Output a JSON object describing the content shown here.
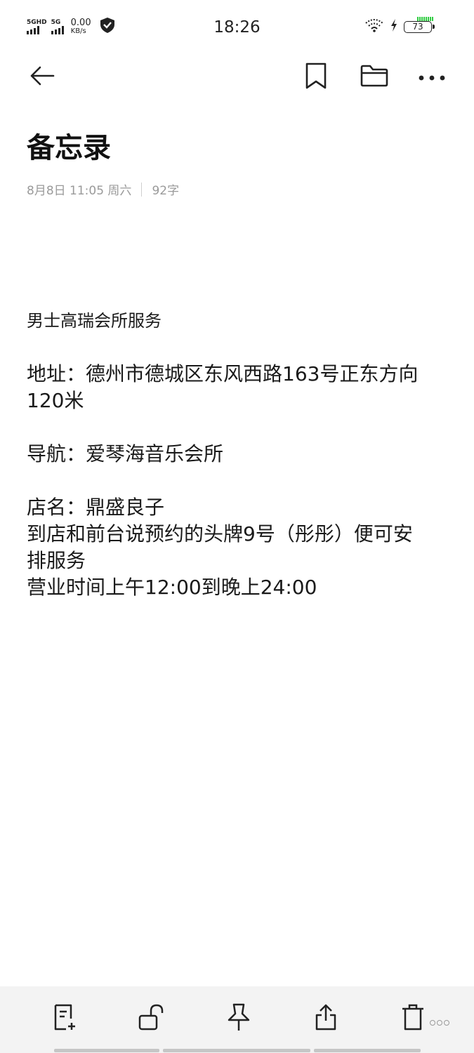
{
  "status_bar": {
    "sim1_label": "5GHD",
    "sim2_label": "5G",
    "speed_value": "0.00",
    "speed_unit": "KB/s",
    "time": "18:26",
    "battery_level": "73"
  },
  "toolbar": {
    "back_icon": "arrow-left-icon",
    "bookmark_icon": "bookmark-icon",
    "folder_icon": "folder-icon",
    "more_icon": "more-icon"
  },
  "note": {
    "title": "备忘录",
    "date": "8月8日 11:05 周六",
    "char_count": "92字",
    "lines": [
      "男士高瑞会所服务",
      "",
      "地址：德州市德城区东风西路163号正东方向",
      "120米",
      "",
      "导航：爱琴海音乐会所",
      "",
      "店名：鼎盛良子",
      "到店和前台说预约的头牌9号（彤彤）便可安",
      "排服务",
      "营业时间上午12:00到晚上24:00"
    ]
  },
  "bottom_bar": {
    "items": [
      {
        "icon": "add-note-icon"
      },
      {
        "icon": "unlock-icon"
      },
      {
        "icon": "pin-icon"
      },
      {
        "icon": "share-icon"
      },
      {
        "icon": "trash-icon"
      }
    ]
  },
  "colors": {
    "background": "#ffffff",
    "text": "#1a1a1a",
    "meta_text": "#9a9a9a",
    "bottom_bar": "#f3f3f3",
    "charge_indicator": "#2ecc40"
  }
}
